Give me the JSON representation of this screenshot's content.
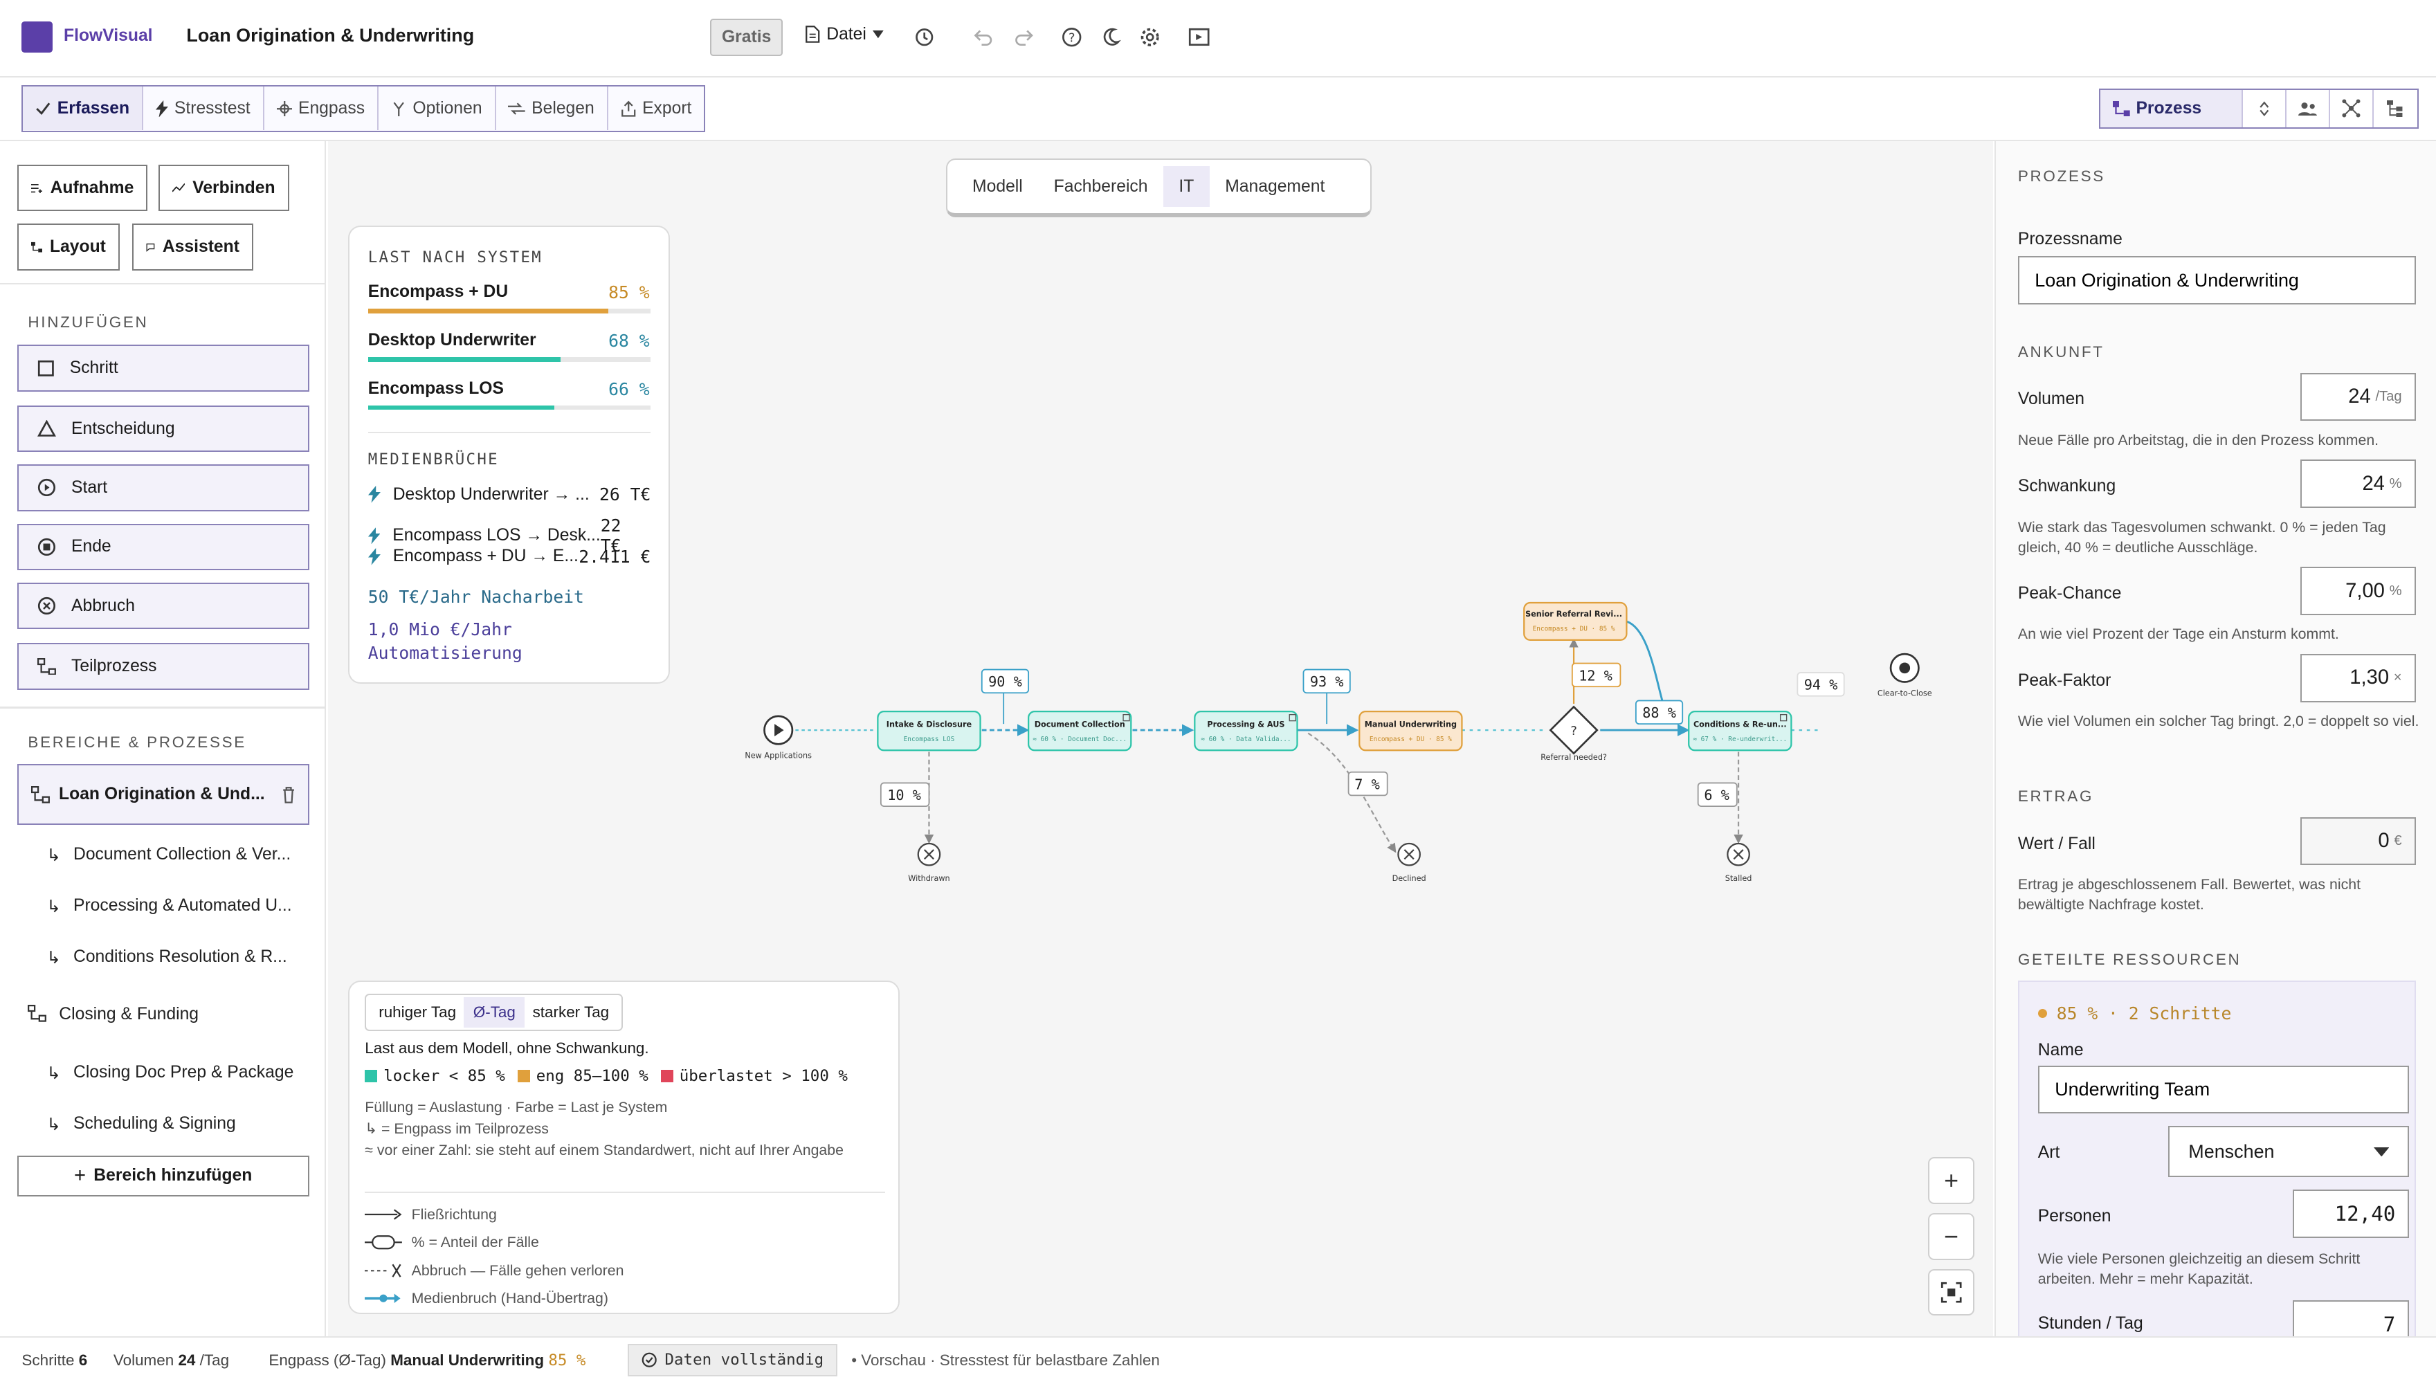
{
  "app": {
    "brand": "FlowVisual",
    "doc_title": "Loan Origination & Underwriting",
    "plan_badge": "Gratis",
    "file_menu": "Datei"
  },
  "colors": {
    "accent": "#5b3fa8",
    "ok": "#2ec4a9",
    "warn": "#e0a03c",
    "over": "#e0455a",
    "teal_node": "#d9f4f0",
    "orange_node": "#fbe7cf"
  },
  "icons": [
    "history-icon",
    "undo-icon",
    "redo-icon",
    "help-icon",
    "dark-mode-icon",
    "settings-icon",
    "present-icon"
  ],
  "modes": [
    {
      "label": "Erfassen",
      "icon": "check-icon",
      "active": true
    },
    {
      "label": "Stresstest",
      "icon": "bolt-icon"
    },
    {
      "label": "Engpass",
      "icon": "crosshair-icon"
    },
    {
      "label": "Optionen",
      "icon": "fork-icon"
    },
    {
      "label": "Belegen",
      "icon": "swap-icon"
    },
    {
      "label": "Export",
      "icon": "export-icon"
    }
  ],
  "view_select": {
    "label": "Prozess"
  },
  "left": {
    "tools": {
      "aufnahme": "Aufnahme",
      "verbinden": "Verbinden",
      "layout": "Layout",
      "assistent": "Assistent"
    },
    "add_title": "HINZUFÜGEN",
    "add_items": [
      "Schritt",
      "Entscheidung",
      "Start",
      "Ende",
      "Abbruch",
      "Teilprozess"
    ],
    "areas_title": "BEREICHE & PROZESSE",
    "selected_process": "Loan Origination & Und...",
    "subprocesses_a": [
      "Document Collection & Ver...",
      "Processing & Automated U...",
      "Conditions Resolution & R..."
    ],
    "area2": "Closing & Funding",
    "subprocesses_b": [
      "Closing Doc Prep & Package",
      "Scheduling & Signing"
    ],
    "add_area": "Bereich hinzufügen"
  },
  "layers": {
    "tabs": [
      "Modell",
      "Fachbereich",
      "IT",
      "Management"
    ],
    "active": "IT"
  },
  "load_card": {
    "title": "LAST NACH SYSTEM",
    "systems": [
      {
        "name": "Encompass + DU",
        "value": "85 %",
        "pct": 0.85,
        "color": "#e0a03c"
      },
      {
        "name": "Desktop Underwriter",
        "value": "68 %",
        "pct": 0.68,
        "color": "#2ec4a9"
      },
      {
        "name": "Encompass LOS",
        "value": "66 %",
        "pct": 0.66,
        "color": "#2ec4a9"
      }
    ],
    "media_title": "MEDIENBRÜCHE",
    "breaks": [
      {
        "label": "Desktop Underwriter → ...",
        "value": "26 T€"
      },
      {
        "label": "Encompass LOS → Desk...",
        "value": "22 T€"
      },
      {
        "label": "Encompass + DU → E...",
        "value": "2.411 €"
      }
    ],
    "sum1": "50 T€/Jahr Nacharbeit",
    "sum2": "1,0 Mio €/Jahr Automatisierung"
  },
  "diagram": {
    "start": "New Applications",
    "nodes": [
      {
        "title": "Intake & Disclosure",
        "sub": "Encompass LOS"
      },
      {
        "title": "Document Collection",
        "sub": "≈ 60 % · Document Doc..."
      },
      {
        "title": "Processing & AUS",
        "sub": "≈ 60 % · Data Valida..."
      },
      {
        "title": "Manual Underwriting",
        "sub": "Encompass + DU · 85 %"
      },
      {
        "title": "Senior Referral Revi...",
        "sub": "Encompass + DU · 85 %"
      },
      {
        "title": "Conditions & Re-un...",
        "sub": "≈ 67 % · Re-underwrit..."
      }
    ],
    "decision": {
      "symbol": "?",
      "label": "Referral needed?"
    },
    "ends": {
      "withdrawn": "Withdrawn",
      "declined": "Declined",
      "stalled": "Stalled",
      "close": "Clear-to-Close"
    },
    "pcts": {
      "p90": "90 %",
      "p93": "93 %",
      "p12": "12 %",
      "p88": "88 %",
      "p94": "94 %",
      "p10": "10 %",
      "p7": "7 %",
      "p6": "6 %"
    }
  },
  "legend": {
    "day_tabs": [
      "ruhiger Tag",
      "Ø-Tag",
      "starker Tag"
    ],
    "active_day": "Ø-Tag",
    "desc": "Last aus dem Modell, ohne Schwankung.",
    "scale": [
      {
        "label": "locker < 85 %",
        "color": "#2ec4a9"
      },
      {
        "label": "eng 85–100 %",
        "color": "#e0a03c"
      },
      {
        "label": "überlastet > 100 %",
        "color": "#e0455a"
      }
    ],
    "notes": [
      "Füllung = Auslastung · Farbe = Last je System",
      "↳ = Engpass im Teilprozess",
      "≈ vor einer Zahl: sie steht auf einem Standardwert, nicht auf Ihrer Angabe"
    ],
    "keys": [
      "Fließrichtung",
      "% = Anteil der Fälle",
      "Abbruch — Fälle gehen verloren",
      "Medienbruch (Hand-Übertrag)"
    ]
  },
  "right": {
    "title": "PROZESS",
    "name_label": "Prozessname",
    "name_value": "Loan Origination & Underwriting",
    "arrival_title": "ANKUNFT",
    "volume": {
      "label": "Volumen",
      "value": "24",
      "unit": "/Tag",
      "help": "Neue Fälle pro Arbeitstag, die in den Prozess kommen."
    },
    "variation": {
      "label": "Schwankung",
      "value": "24",
      "unit": "%",
      "help": "Wie stark das Tagesvolumen schwankt. 0 % = jeden Tag gleich, 40 % = deutliche Ausschläge."
    },
    "peak_chance": {
      "label": "Peak-Chance",
      "value": "7,00",
      "unit": "%",
      "help": "An wie viel Prozent der Tage ein Ansturm kommt."
    },
    "peak_factor": {
      "label": "Peak-Faktor",
      "value": "1,30",
      "unit": "×",
      "help": "Wie viel Volumen ein solcher Tag bringt. 2,0 = doppelt so viel."
    },
    "revenue_title": "ERTRAG",
    "value_case": {
      "label": "Wert / Fall",
      "value": "0",
      "unit": "€",
      "help": "Ertrag je abgeschlossenem Fall. Bewertet, was nicht bewältigte Nachfrage kostet."
    },
    "shared_title": "GETEILTE RESSOURCEN",
    "resource": {
      "summary": "85 % · 2 Schritte",
      "name_label": "Name",
      "name": "Underwriting Team",
      "type_label": "Art",
      "type": "Menschen",
      "persons_label": "Personen",
      "persons": "12,40",
      "persons_help": "Wie viele Personen gleichzeitig an diesem Schritt arbeiten. Mehr = mehr Kapazität.",
      "hours_label": "Stunden / Tag",
      "hours": "7"
    }
  },
  "status": {
    "steps_label": "Schritte",
    "steps": "6",
    "vol_label": "Volumen",
    "vol": "24",
    "vol_unit": "/Tag",
    "bottleneck_label": "Engpass (Ø-Tag)",
    "bottleneck": "Manual Underwriting",
    "bottleneck_pct": "85 %",
    "data_badge": "Daten vollständig",
    "preview": "• Vorschau · Stresstest für belastbare Zahlen"
  }
}
